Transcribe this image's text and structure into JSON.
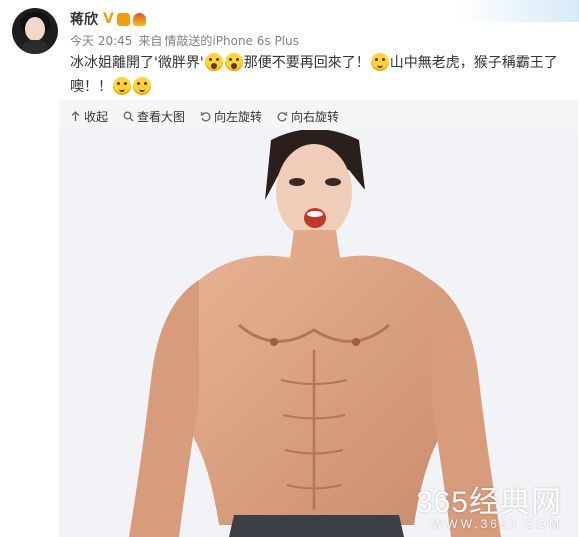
{
  "post": {
    "author": "蒋欣",
    "verified_mark": "V",
    "time": "今天 20:45",
    "source_prefix": "来自",
    "source": "情敲送的iPhone 6s Plus",
    "text": {
      "p1": "冰冰姐離開了'微胖界'",
      "p2": "那便不要再回來了！",
      "p3": "山中無老虎，猴子稱霸王了噢！！"
    }
  },
  "media": {
    "toolbar": [
      {
        "icon": "arrow-up-icon",
        "label": "收起"
      },
      {
        "icon": "magnifier-icon",
        "label": "查看大图"
      },
      {
        "icon": "rotate-left-icon",
        "label": "向左旋转"
      },
      {
        "icon": "rotate-right-icon",
        "label": "向右旋转"
      }
    ],
    "watermark": {
      "big": "365经典网",
      "small": "WWW.365J.COM"
    }
  },
  "colors": {
    "author": "#333333",
    "meta": "#808080",
    "accent_v": "#f6a000",
    "emoji": "#ffd43b"
  }
}
